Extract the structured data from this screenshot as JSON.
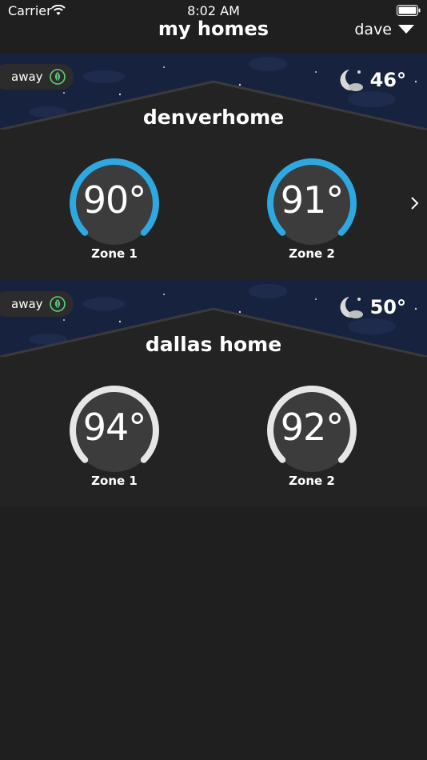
{
  "status_bar": {
    "carrier": "Carrier",
    "time": "8:02 AM"
  },
  "nav": {
    "title": "my homes",
    "user": "dave"
  },
  "colors": {
    "active_ring": "#2ea8e0",
    "inactive_ring": "#e6e6e6",
    "sky": "#17223f",
    "leaf": "#5fcf7b"
  },
  "homes": [
    {
      "name": "denverhome",
      "mode": "away",
      "outside_temp": "46°",
      "zones": [
        {
          "temp": "90°",
          "label": "Zone 1",
          "active": true
        },
        {
          "temp": "91°",
          "label": "Zone 2",
          "active": true
        }
      ]
    },
    {
      "name": "dallas home",
      "mode": "away",
      "outside_temp": "50°",
      "zones": [
        {
          "temp": "94°",
          "label": "Zone 1",
          "active": false
        },
        {
          "temp": "92°",
          "label": "Zone 2",
          "active": false
        }
      ]
    }
  ]
}
